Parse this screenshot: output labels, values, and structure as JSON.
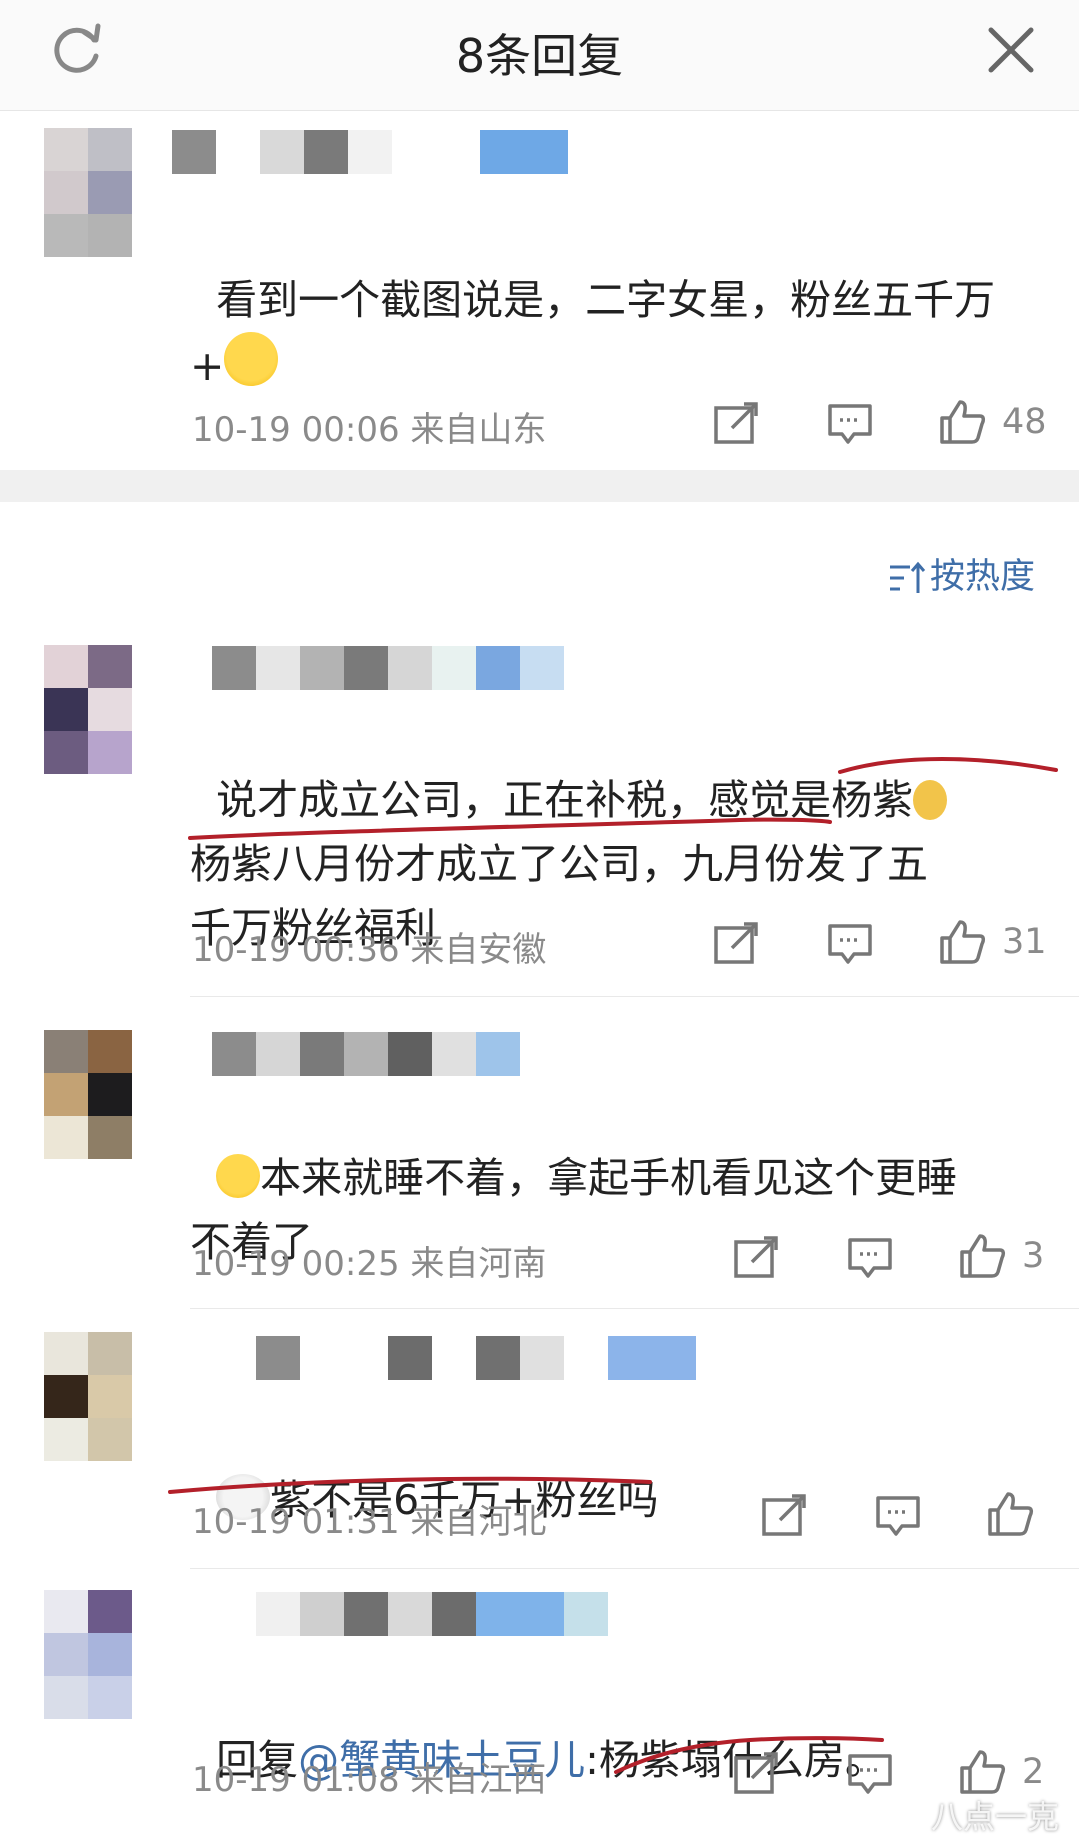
{
  "header": {
    "title": "8条回复"
  },
  "sort": {
    "label": "按热度"
  },
  "comments": [
    {
      "text_a": "看到一个截图说是，二字女星，粉丝五千万",
      "text_b": "+",
      "time": "10-19 00:06",
      "location": "来自山东",
      "likes": "48"
    },
    {
      "text_l1": "说才成立公司，正在补税，感觉是杨紫",
      "text_l2": "杨紫八月份才成立了公司，九月份发了五",
      "text_l3": "千万粉丝福利",
      "time": "10-19 00:36",
      "location": "来自安徽",
      "likes": "31"
    },
    {
      "text_l1": "本来就睡不着，拿起手机看见这个更睡",
      "text_l2": "不着了",
      "time": "10-19 00:25",
      "location": "来自河南",
      "likes": "3"
    },
    {
      "text": "紫不是6千万+粉丝吗",
      "time": "10-19 01:31",
      "location": "来自河北",
      "likes": ""
    },
    {
      "reply_prefix": "回复",
      "mention": "@蟹黄味土豆儿",
      "text": ":杨紫塌什么房。",
      "time": "10-19 01:08",
      "location": "来自江西",
      "likes": "2"
    }
  ],
  "watermark": "八点一克",
  "colors": {
    "accent": "#3f6ea8",
    "meta_gray": "#8a8a8a",
    "underline_red": "#b3202a"
  },
  "icons": [
    "refresh-icon",
    "close-icon",
    "share-icon",
    "comment-icon",
    "like-icon",
    "sort-icon"
  ]
}
